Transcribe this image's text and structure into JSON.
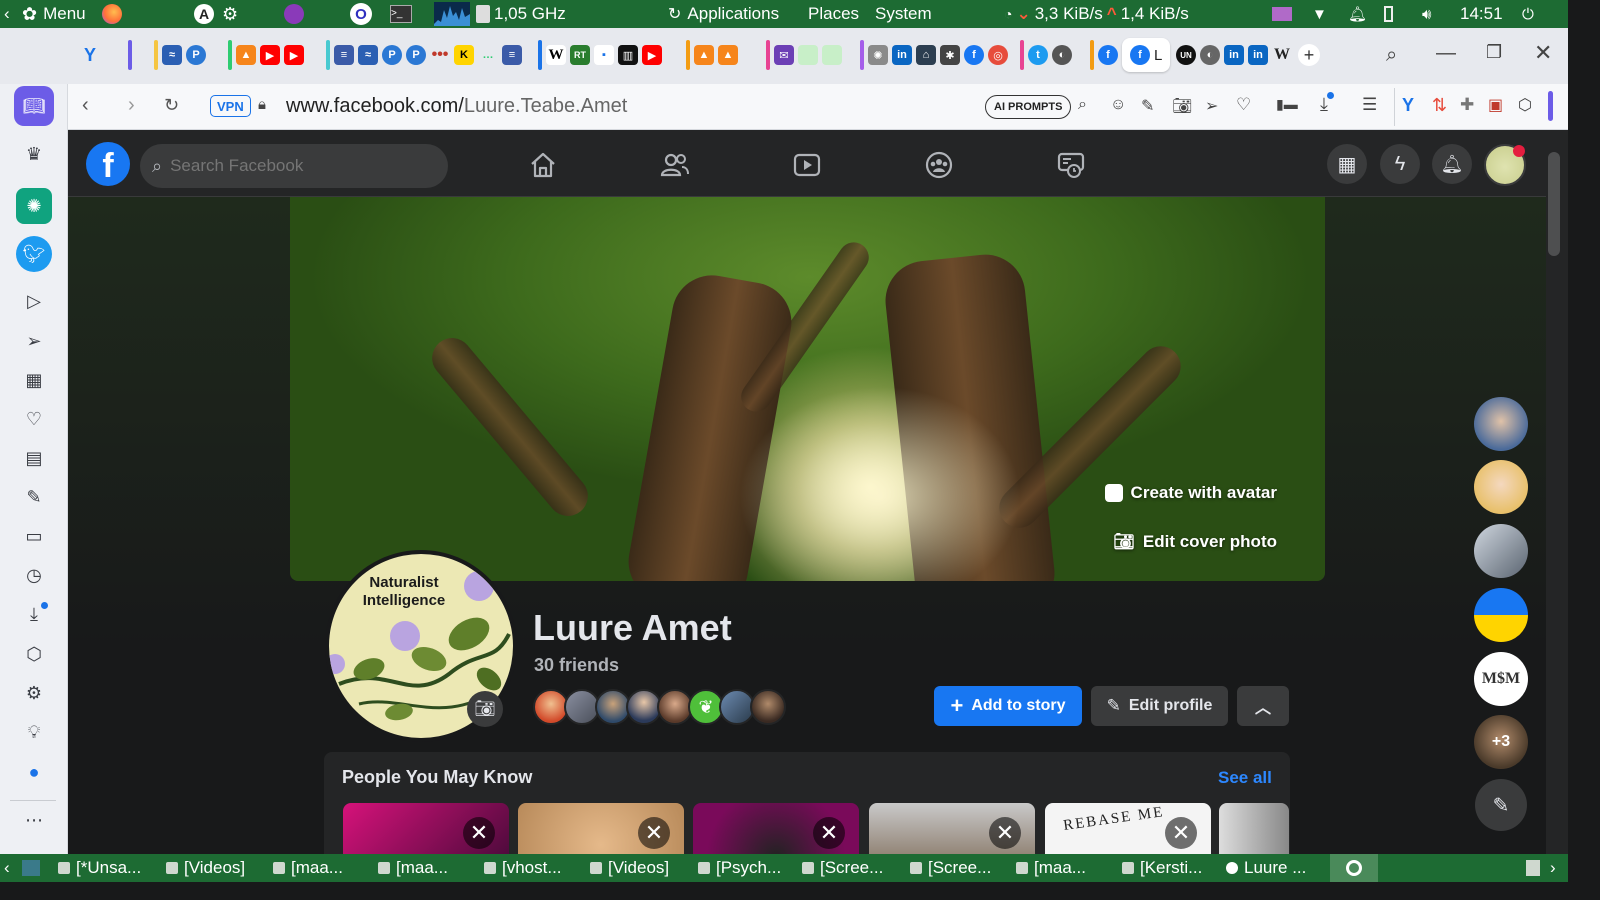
{
  "os_panel": {
    "menu_label": "Menu",
    "cpu_freq": "1,05 GHz",
    "applications_label": "Applications",
    "places_label": "Places",
    "system_label": "System",
    "net_down": "3,3 KiB/s",
    "net_up": "1,4 KiB/s",
    "clock": "14:51"
  },
  "browser": {
    "vpn_badge": "VPN",
    "url_domain": "www.facebook.com/",
    "url_path": "Luure.Teabe.Amet",
    "ai_prompts_label": "AI PROMPTS",
    "active_tab_letter": "L"
  },
  "facebook": {
    "search_placeholder": "Search Facebook",
    "profile_name": "Luure Amet",
    "friends_count": "30 friends",
    "create_avatar_label": "Create with avatar",
    "edit_cover_label": "Edit cover photo",
    "add_story_label": "Add to story",
    "edit_profile_label": "Edit profile",
    "avatar_title_line1": "Naturalist",
    "avatar_title_line2": "Intelligence",
    "pymk_title": "People You May Know",
    "see_all_label": "See all",
    "contacts_more": "+3",
    "pymk_card_text": "REBASE ME"
  },
  "taskbar": {
    "items": [
      "[*Unsa...",
      "[Videos]",
      "[maa...",
      "[maa...",
      "[vhost...",
      "[Videos]",
      "[Psych...",
      "[Scree...",
      "[Scree...",
      "[maa...",
      "[Kersti...",
      "Luure ..."
    ]
  },
  "colors": {
    "os_green": "#1d6b33",
    "fb_blue": "#1877f2",
    "fb_dark": "#18191a",
    "fb_surface": "#242526"
  }
}
